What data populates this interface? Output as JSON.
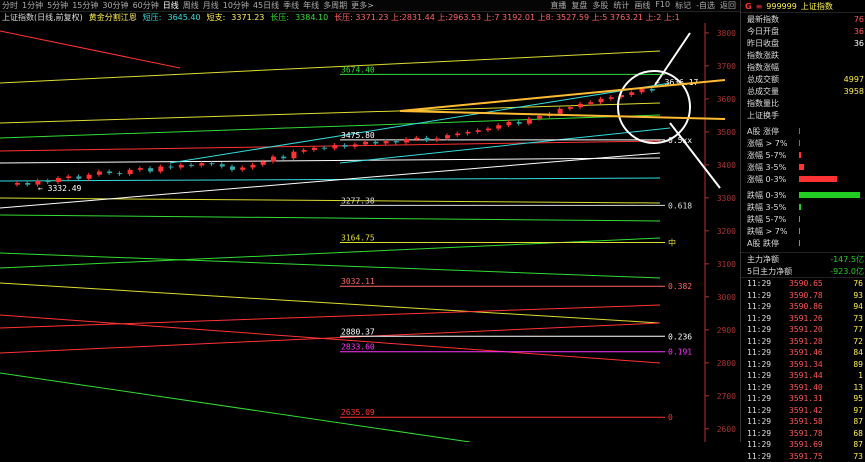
{
  "toolbar": {
    "tabs": [
      "分时",
      "1分钟",
      "5分钟",
      "15分钟",
      "30分钟",
      "60分钟",
      "日线",
      "周线",
      "月线",
      "10分钟",
      "45日线",
      "季线",
      "年线",
      "多周期",
      "更多>"
    ],
    "active_tab": "日线",
    "right": [
      "直播",
      "复盘",
      "多股",
      "统计",
      "画线",
      "F10",
      "标记",
      "-自选",
      "返回"
    ]
  },
  "info": {
    "name": "上证指数(日线,前复权)",
    "fib_title": "黄金分割江恩",
    "dz_label": "短压:",
    "dz_val": "3645.40",
    "dc_label": "短支:",
    "dc_val": "3371.23",
    "cy_label": "长压:",
    "cy_val": "3384.10",
    "extra": "长压: 3371.23  上:2831.44 上:2963.53 上:7 3192.01  上8: 3527.59 上:5  3763.21 上:2 上:1",
    "extra2": "上:1   F9: 356("
  },
  "chart": {
    "y_ticks": [
      "3800",
      "3700",
      "3600",
      "3500",
      "3400",
      "3300",
      "3200",
      "3100",
      "3000",
      "2900",
      "2800",
      "2700",
      "2600"
    ],
    "fib_levels": [
      {
        "price": "3674.40",
        "ratio": "",
        "color": "#33dd33"
      },
      {
        "price": "3475.80",
        "ratio": "0.5xx",
        "color": "#ffffff"
      },
      {
        "price": "3277.38",
        "ratio": "0.618",
        "color": "#dddddd"
      },
      {
        "price": "3164.75",
        "ratio": "中",
        "color": "#dddd33"
      },
      {
        "price": "3032.11",
        "ratio": "0.382",
        "color": "#ff6666"
      },
      {
        "price": "2880.37",
        "ratio": "0.236",
        "color": "#ffffff"
      },
      {
        "price": "2833.60",
        "ratio": "0.191",
        "color": "#ff33ff"
      },
      {
        "price": "2635.09",
        "ratio": "0",
        "color": "#ff3333"
      }
    ],
    "hi_label": "3636.17",
    "lo_label": "3332.49",
    "hi_price": 3636.17,
    "lo_price": 3332.49
  },
  "panel": {
    "code": "999999",
    "name": "上证指数",
    "rows": [
      {
        "label": "最新指数",
        "value": "76",
        "color": "#ff5555"
      },
      {
        "label": "今日开盘",
        "value": "36",
        "color": "#ff5555"
      },
      {
        "label": "昨日收盘",
        "value": "36",
        "color": "#ffffff"
      },
      {
        "label": "指数涨跌",
        "value": "",
        "color": "#ff5555"
      },
      {
        "label": "指数涨幅",
        "value": "",
        "color": "#ff5555"
      },
      {
        "label": "总成交额",
        "value": "4997",
        "color": "#ffee55"
      },
      {
        "label": "总成交量",
        "value": "3958",
        "color": "#ffee55"
      },
      {
        "label": "指数量比",
        "value": "",
        "color": "#ffee55"
      },
      {
        "label": "上证换手",
        "value": "",
        "color": "#ffee55"
      }
    ],
    "up_bars": [
      {
        "label": "A股 涨停",
        "width": 0.02,
        "color": "#ff3333"
      },
      {
        "label": "涨幅 > 7%",
        "width": 0.02,
        "color": "#ff3333"
      },
      {
        "label": "涨幅 5-7%",
        "width": 0.03,
        "color": "#ff3333"
      },
      {
        "label": "涨幅 3-5%",
        "width": 0.08,
        "color": "#ff3333"
      },
      {
        "label": "涨幅 0-3%",
        "width": 0.6,
        "color": "#ff3333"
      }
    ],
    "down_bars": [
      {
        "label": "跌幅 0-3%",
        "width": 0.95,
        "color": "#22cc22"
      },
      {
        "label": "跌幅 3-5%",
        "width": 0.03,
        "color": "#22cc22"
      },
      {
        "label": "跌幅 5-7%",
        "width": 0.02,
        "color": "#22cc22"
      },
      {
        "label": "跌幅 > 7%",
        "width": 0.02,
        "color": "#22cc22"
      },
      {
        "label": "A股 跌停",
        "width": 0.02,
        "color": "#22cc22"
      }
    ],
    "flow1_label": "主力净额",
    "flow1_value": "-147.5亿",
    "flow2_label": "5日主力净额",
    "flow2_value": "-923.0亿",
    "ticks": [
      [
        "11:29",
        "3590.65",
        "76"
      ],
      [
        "11:29",
        "3590.78",
        "93"
      ],
      [
        "11:29",
        "3590.86",
        "94"
      ],
      [
        "11:29",
        "3591.26",
        "73"
      ],
      [
        "11:29",
        "3591.20",
        "77"
      ],
      [
        "11:29",
        "3591.28",
        "72"
      ],
      [
        "11:29",
        "3591.46",
        "84"
      ],
      [
        "11:29",
        "3591.34",
        "89"
      ],
      [
        "11:29",
        "3591.44",
        "1"
      ],
      [
        "11:29",
        "3591.40",
        "13"
      ],
      [
        "11:29",
        "3591.31",
        "95"
      ],
      [
        "11:29",
        "3591.42",
        "97"
      ],
      [
        "11:29",
        "3591.58",
        "87"
      ],
      [
        "11:29",
        "3591.78",
        "68"
      ],
      [
        "11:29",
        "3591.69",
        "87"
      ],
      [
        "11:29",
        "3591.75",
        "73"
      ]
    ]
  }
}
